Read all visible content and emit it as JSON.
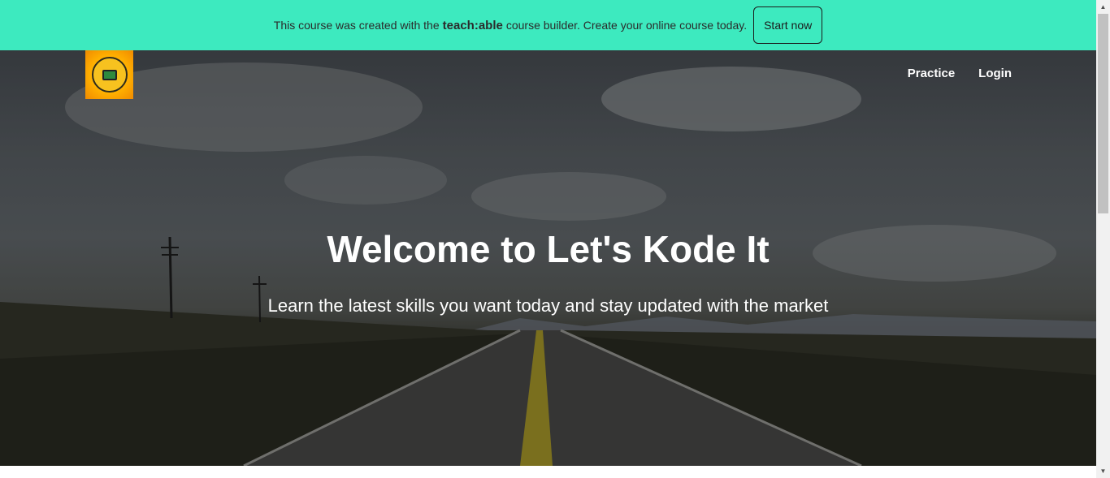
{
  "banner": {
    "text_before": "This course was created with the",
    "brand": "teach:able",
    "text_after": "course builder. Create your online course today.",
    "cta_label": "Start now",
    "background": "#3deabf"
  },
  "header": {
    "logo_icon": "lets-kode-it-logo",
    "nav": [
      {
        "label": "Practice"
      },
      {
        "label": "Login"
      }
    ]
  },
  "hero": {
    "title": "Welcome to Let's Kode It",
    "subtitle": "Learn the latest skills you want today and stay updated with the market"
  }
}
